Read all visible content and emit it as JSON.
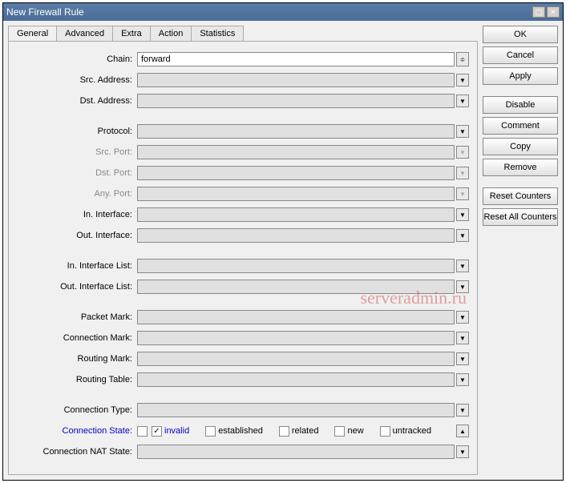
{
  "window": {
    "title": "New Firewall Rule"
  },
  "tabs": [
    "General",
    "Advanced",
    "Extra",
    "Action",
    "Statistics"
  ],
  "activeTab": 0,
  "fields": {
    "chain": {
      "label": "Chain:",
      "value": "forward"
    },
    "srcAddress": {
      "label": "Src. Address:",
      "value": ""
    },
    "dstAddress": {
      "label": "Dst. Address:",
      "value": ""
    },
    "protocol": {
      "label": "Protocol:",
      "value": ""
    },
    "srcPort": {
      "label": "Src. Port:",
      "value": ""
    },
    "dstPort": {
      "label": "Dst. Port:",
      "value": ""
    },
    "anyPort": {
      "label": "Any. Port:",
      "value": ""
    },
    "inInterface": {
      "label": "In. Interface:",
      "value": ""
    },
    "outInterface": {
      "label": "Out. Interface:",
      "value": ""
    },
    "inInterfaceList": {
      "label": "In. Interface List:",
      "value": ""
    },
    "outInterfaceList": {
      "label": "Out. Interface List:",
      "value": ""
    },
    "packetMark": {
      "label": "Packet Mark:",
      "value": ""
    },
    "connectionMark": {
      "label": "Connection Mark:",
      "value": ""
    },
    "routingMark": {
      "label": "Routing Mark:",
      "value": ""
    },
    "routingTable": {
      "label": "Routing Table:",
      "value": ""
    },
    "connectionType": {
      "label": "Connection Type:",
      "value": ""
    },
    "connectionState": {
      "label": "Connection State:",
      "options": [
        {
          "label": "invalid",
          "checked": true
        },
        {
          "label": "established",
          "checked": false
        },
        {
          "label": "related",
          "checked": false
        },
        {
          "label": "new",
          "checked": false
        },
        {
          "label": "untracked",
          "checked": false
        }
      ]
    },
    "connectionNatState": {
      "label": "Connection NAT State:",
      "value": ""
    }
  },
  "buttons": [
    "OK",
    "Cancel",
    "Apply",
    "Disable",
    "Comment",
    "Copy",
    "Remove",
    "Reset Counters",
    "Reset All Counters"
  ],
  "watermark": "serveradmin.ru"
}
